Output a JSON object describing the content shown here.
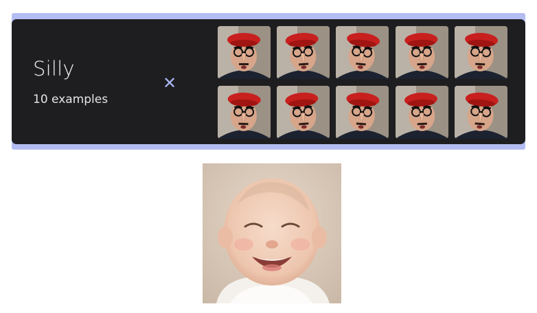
{
  "card": {
    "title": "Silly",
    "count_label": "10 examples",
    "close_glyph": "✕",
    "frame_color": "#b3bdf2",
    "panel_color": "#1e1e20",
    "accent_color": "#aab6f5"
  },
  "thumbnails": [
    {
      "name": "thumbnail-silly-1"
    },
    {
      "name": "thumbnail-silly-2"
    },
    {
      "name": "thumbnail-silly-3"
    },
    {
      "name": "thumbnail-silly-4"
    },
    {
      "name": "thumbnail-silly-5"
    },
    {
      "name": "thumbnail-silly-6"
    },
    {
      "name": "thumbnail-silly-7"
    },
    {
      "name": "thumbnail-silly-8"
    },
    {
      "name": "thumbnail-silly-9"
    },
    {
      "name": "thumbnail-silly-10"
    }
  ],
  "preview": {
    "name": "laughing-baby-photo"
  }
}
